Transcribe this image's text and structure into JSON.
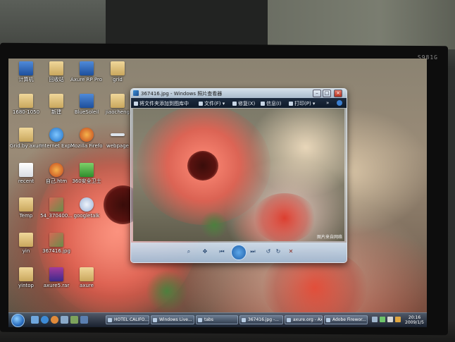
{
  "monitor": {
    "model_label": "S981G"
  },
  "desktop": {
    "icons": [
      {
        "label": "计算机",
        "icon": "computer-icon"
      },
      {
        "label": "回收站",
        "icon": "recycle-bin-icon"
      },
      {
        "label": "Axure RP Pro 5",
        "icon": "axure-app-icon"
      },
      {
        "label": "grid",
        "icon": "folder-icon"
      },
      {
        "label": "1680-1050",
        "icon": "folder-icon"
      },
      {
        "label": "新建",
        "icon": "folder-icon"
      },
      {
        "label": "BlueSoleil",
        "icon": "bluetooth-icon"
      },
      {
        "label": "jiaocheng",
        "icon": "folder-icon"
      },
      {
        "label": "Grid.by axure.org",
        "icon": "folder-icon"
      },
      {
        "label": "Internet Explorer",
        "icon": "ie-icon"
      },
      {
        "label": "Mozilla Firefox",
        "icon": "firefox-icon"
      },
      {
        "label": "webpage",
        "icon": "document-icon"
      },
      {
        "label": "recent",
        "icon": "document-icon"
      },
      {
        "label": "自己.htm",
        "icon": "firefox-doc-icon"
      },
      {
        "label": "360安全卫士",
        "icon": "shield-icon"
      },
      {
        "label": "Temp",
        "icon": "folder-icon"
      },
      {
        "label": "54_370400...",
        "icon": "image-icon"
      },
      {
        "label": "googletalk",
        "icon": "googletalk-icon"
      },
      {
        "label": "yin",
        "icon": "folder-icon"
      },
      {
        "label": "367416.jpg",
        "icon": "image-icon"
      },
      {
        "label": "yintop",
        "icon": "folder-icon"
      },
      {
        "label": "axure5.rar",
        "icon": "rar-icon"
      },
      {
        "label": "axure",
        "icon": "folder-icon"
      }
    ]
  },
  "viewer": {
    "title": "367416.jpg - Windows 照片查看器",
    "menu": [
      {
        "label": "将文件夹添加到图库中"
      },
      {
        "label": "文件(F) ▾"
      },
      {
        "label": "修复(X)"
      },
      {
        "label": "信息(I)"
      },
      {
        "label": "打印(P) ▾"
      },
      {
        "label": "»"
      }
    ],
    "watermark": "图片来自网络",
    "controls": {
      "zoom": "⌕",
      "fit": "✥",
      "prev": "⏮",
      "play": "▶",
      "next": "⏭",
      "rotate_left": "↺",
      "rotate_right": "↻",
      "delete": "✕"
    }
  },
  "taskbar": {
    "buttons": [
      {
        "label": "HOTEL CALIFO..."
      },
      {
        "label": "Windows Live..."
      },
      {
        "label": "tabs"
      },
      {
        "label": "367416.jpg -..."
      },
      {
        "label": "axure.org - Ax..."
      },
      {
        "label": "Adobe Firewor..."
      }
    ],
    "clock": {
      "time": "20:16",
      "date": "2009/1/5"
    }
  },
  "colors": {
    "taskbar": "#1a2635",
    "viewer_menubar": "#13202f",
    "bezel": "#0d0d0d"
  }
}
